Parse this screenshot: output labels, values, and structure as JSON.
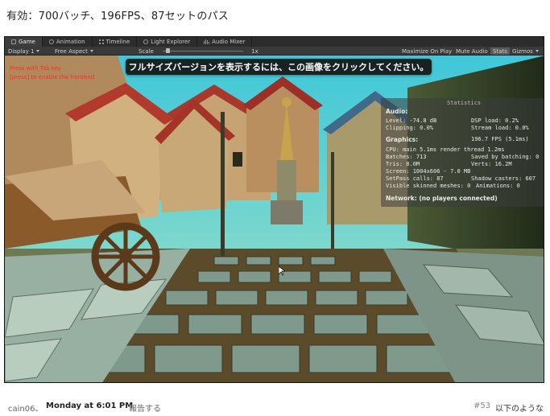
{
  "post": {
    "text": "有効：700バッチ、196FPS、87セットのパス"
  },
  "editor": {
    "tabs": [
      {
        "label": "Game",
        "icon": "game-icon"
      },
      {
        "label": "Animation",
        "icon": "animation-icon"
      },
      {
        "label": "Timeline",
        "icon": "timeline-icon"
      },
      {
        "label": "Light Explorer",
        "icon": "light-icon"
      },
      {
        "label": "Audio Mixer",
        "icon": "audio-mixer-icon"
      }
    ],
    "toolbar": {
      "display": "Display 1",
      "aspect": "Free Aspect",
      "scale_label": "Scale",
      "scale_value": "1x",
      "maximize": "Maximize On Play",
      "mute": "Mute Audio",
      "stats": "Stats",
      "gizmos": "Gizmos"
    }
  },
  "game_view": {
    "debug_line1": "Press with Tab key",
    "debug_line2": "[press] to enable the frontend",
    "tooltip": "フルサイズバージョンを表示するには、この画像をクリックしてください。"
  },
  "stats": {
    "title": "Statistics",
    "audio_header": "Audio:",
    "level": "Level: -74.8 dB",
    "dsp": "DSP load: 0.2%",
    "clipping": "Clipping: 0.0%",
    "stream": "Stream load: 0.0%",
    "graphics_header": "Graphics:",
    "fps": "196.7 FPS (5.1ms)",
    "cpu": "CPU: main 5.1ms  render thread 1.2ms",
    "batches": "Batches: 713",
    "saved": "Saved by batching: 0",
    "tris": "Tris: 8.0M",
    "verts": "Verts: 16.2M",
    "screen": "Screen: 1004x606 - 7.0 MB",
    "setpass": "SetPass calls: 87",
    "shadow": "Shadow casters: 607",
    "skinned": "Visible skinned meshes: 0",
    "anims": "Animations: 0",
    "network": "Network: (no players connected)"
  },
  "footer": {
    "user": "cain06、",
    "time": "Monday at 6:01 PM",
    "report": "報告する",
    "post_number": "#53",
    "more": "以下のような"
  }
}
